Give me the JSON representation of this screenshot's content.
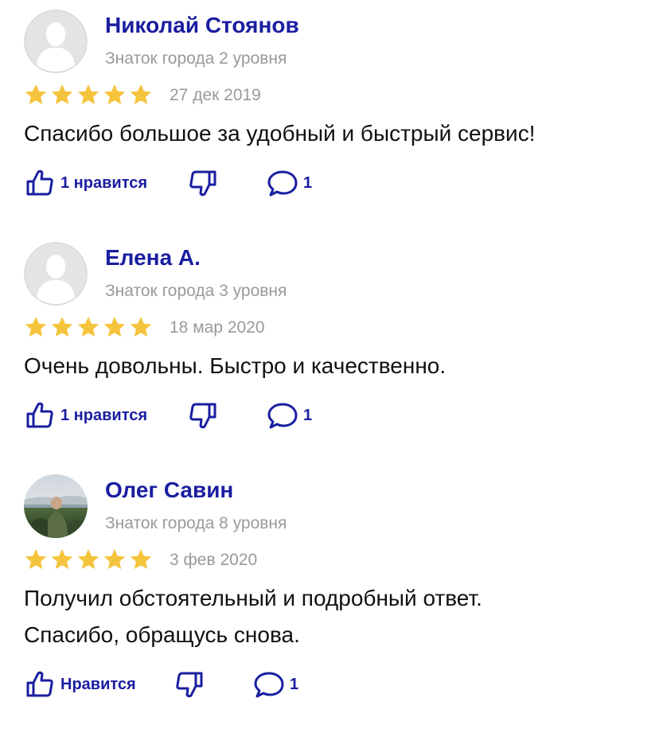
{
  "colors": {
    "name": "#1a1ea0",
    "meta": "#9a9a9a",
    "star": "#f5c43d",
    "action": "#1a1ea0"
  },
  "reviews": [
    {
      "author": "Николай Стоянов",
      "level": "Знаток города 2 уровня",
      "rating": 5,
      "date": "27 дек 2019",
      "text": [
        "Спасибо большое за удобный и быстрый сервис!"
      ],
      "like_label": "1 нравится",
      "comments": "1",
      "avatar": "placeholder-avatar"
    },
    {
      "author": "Елена А.",
      "level": "Знаток города 3 уровня",
      "rating": 5,
      "date": "18 мар 2020",
      "text": [
        "Очень довольны. Быстро и качественно."
      ],
      "like_label": "1 нравится",
      "comments": "1",
      "avatar": "placeholder-avatar"
    },
    {
      "author": "Олег Савин",
      "level": "Знаток города 8 уровня",
      "rating": 5,
      "date": "3 фев 2020",
      "text": [
        "Получил обстоятельный и подробный ответ.",
        "Спасибо, обращусь снова."
      ],
      "like_label": "Нравится",
      "comments": "1",
      "avatar": "photo-avatar"
    }
  ]
}
